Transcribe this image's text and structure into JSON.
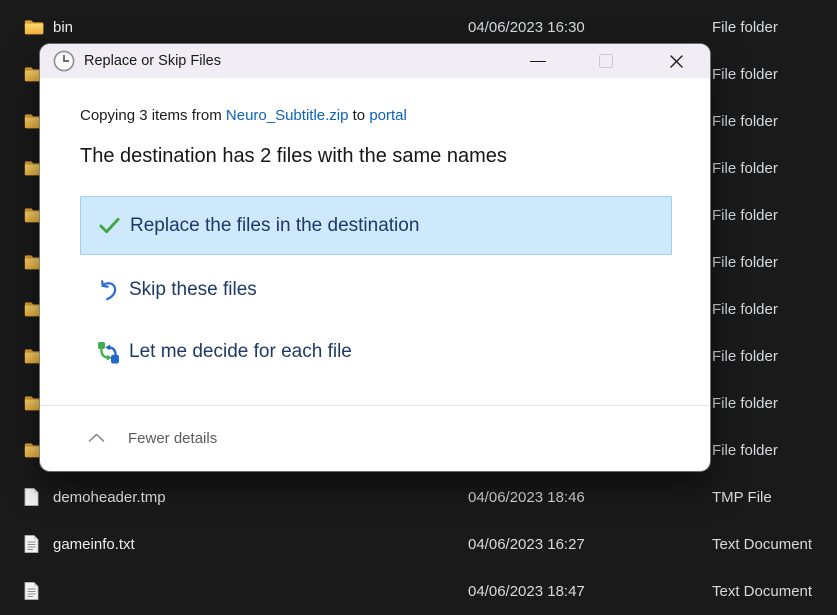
{
  "dialog": {
    "title": "Replace or Skip Files",
    "title_icon": "clock-icon",
    "copy_line": {
      "prefix": "Copying 3 items from ",
      "source": "Neuro_Subtitle.zip",
      "connector": " to ",
      "destination": "portal"
    },
    "heading": "The destination has 2 files with the same names",
    "options": [
      {
        "id": "replace",
        "icon": "check-icon",
        "label": "Replace the files in the destination",
        "selected": true
      },
      {
        "id": "skip",
        "icon": "undo-arrow-icon",
        "label": "Skip these files",
        "selected": false
      },
      {
        "id": "decide",
        "icon": "swap-arrows-icon",
        "label": "Let me decide for each file",
        "selected": false
      }
    ],
    "footer_toggle": {
      "icon": "chevron-up-icon",
      "label": "Fewer details"
    }
  },
  "explorer": {
    "rows": [
      {
        "icon": "folder",
        "name": "bin",
        "date": "04/06/2023 16:30",
        "type": "File folder"
      },
      {
        "icon": "folder",
        "name": "",
        "date": "",
        "type": "File folder"
      },
      {
        "icon": "folder",
        "name": "",
        "date": "",
        "type": "File folder"
      },
      {
        "icon": "folder",
        "name": "",
        "date": "",
        "type": "File folder"
      },
      {
        "icon": "folder",
        "name": "",
        "date": "",
        "type": "File folder"
      },
      {
        "icon": "folder",
        "name": "",
        "date": "",
        "type": "File folder"
      },
      {
        "icon": "folder",
        "name": "",
        "date": "",
        "type": "File folder"
      },
      {
        "icon": "folder",
        "name": "",
        "date": "",
        "type": "File folder"
      },
      {
        "icon": "folder",
        "name": "",
        "date": "",
        "type": "File folder"
      },
      {
        "icon": "folder",
        "name": "",
        "date": "",
        "type": "File folder"
      },
      {
        "icon": "file-blank",
        "name": "demoheader.tmp",
        "date": "04/06/2023 18:46",
        "type": "TMP File"
      },
      {
        "icon": "file-text",
        "name": "gameinfo.txt",
        "date": "04/06/2023 16:27",
        "type": "Text Document"
      },
      {
        "icon": "file-text",
        "name": "",
        "date": "04/06/2023 18:47",
        "type": "Text Document"
      }
    ]
  },
  "colors": {
    "explorer_bg": "#1a1a1a",
    "dialog_titlebar": "#f0eef4",
    "selection_bg": "#cde9fb",
    "selection_border": "#9fd2f2",
    "link_blue": "#0b63bb",
    "option_text": "#1d3a66",
    "check_green": "#42a645",
    "arrow_blue": "#2e6ed2",
    "folder_yellow": "#f5bc45"
  }
}
